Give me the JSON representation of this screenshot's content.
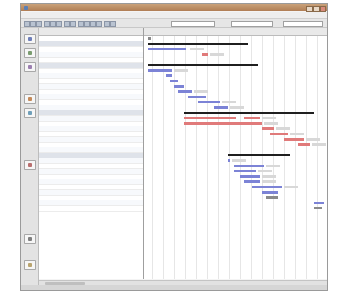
{
  "app": {
    "title": "",
    "icon": "app-icon"
  },
  "menus": [
    "",
    "",
    "",
    "",
    "",
    ""
  ],
  "columns": {
    "id": "",
    "name": "",
    "duration": ""
  },
  "rows": [
    {
      "id": "",
      "name": "",
      "duration": "",
      "kind": "task"
    },
    {
      "id": "",
      "name": "",
      "duration": "",
      "kind": "summary"
    },
    {
      "id": "",
      "name": "",
      "duration": "",
      "kind": "task"
    },
    {
      "id": "",
      "name": "",
      "duration": "",
      "kind": "task"
    },
    {
      "id": "",
      "name": "",
      "duration": "",
      "kind": "task"
    },
    {
      "id": "",
      "name": "",
      "duration": "",
      "kind": "summary"
    },
    {
      "id": "",
      "name": "",
      "duration": "",
      "kind": "task"
    },
    {
      "id": "",
      "name": "",
      "duration": "",
      "kind": "task"
    },
    {
      "id": "",
      "name": "",
      "duration": "",
      "kind": "task"
    },
    {
      "id": "",
      "name": "",
      "duration": "",
      "kind": "task"
    },
    {
      "id": "",
      "name": "",
      "duration": "",
      "kind": "task"
    },
    {
      "id": "",
      "name": "",
      "duration": "",
      "kind": "task"
    },
    {
      "id": "",
      "name": "",
      "duration": "",
      "kind": "task"
    },
    {
      "id": "",
      "name": "",
      "duration": "",
      "kind": "task"
    },
    {
      "id": "",
      "name": "",
      "duration": "",
      "kind": "summary"
    },
    {
      "id": "",
      "name": "",
      "duration": "",
      "kind": "task"
    },
    {
      "id": "",
      "name": "",
      "duration": "",
      "kind": "task"
    },
    {
      "id": "",
      "name": "",
      "duration": "",
      "kind": "task"
    },
    {
      "id": "",
      "name": "",
      "duration": "",
      "kind": "task"
    },
    {
      "id": "",
      "name": "",
      "duration": "",
      "kind": "task"
    },
    {
      "id": "",
      "name": "",
      "duration": "",
      "kind": "task"
    },
    {
      "id": "",
      "name": "",
      "duration": "",
      "kind": "task"
    },
    {
      "id": "",
      "name": "",
      "duration": "",
      "kind": "summary"
    },
    {
      "id": "",
      "name": "",
      "duration": "",
      "kind": "task"
    },
    {
      "id": "",
      "name": "",
      "duration": "",
      "kind": "task"
    },
    {
      "id": "",
      "name": "",
      "duration": "",
      "kind": "task"
    },
    {
      "id": "",
      "name": "",
      "duration": "",
      "kind": "task"
    },
    {
      "id": "",
      "name": "",
      "duration": "",
      "kind": "task"
    },
    {
      "id": "",
      "name": "",
      "duration": "",
      "kind": "task"
    },
    {
      "id": "",
      "name": "",
      "duration": "",
      "kind": "task"
    },
    {
      "id": "",
      "name": "",
      "duration": "",
      "kind": "task"
    },
    {
      "id": "",
      "name": "",
      "duration": "",
      "kind": "task"
    },
    {
      "id": "",
      "name": "",
      "duration": "",
      "kind": "task"
    }
  ],
  "colors": {
    "titlebar": "#b58660",
    "task_bar": "#7c83d6",
    "critical_bar": "#e07a7a",
    "summary_bar": "#1f1f1f",
    "milestone_bar": "#8a8a8a"
  },
  "sidebar_icons": [
    "gantt-view-icon",
    "calendar-view-icon",
    "task-list-icon",
    "resource-icon",
    "chart-icon",
    "report-icon",
    "settings-icon",
    "help-icon"
  ]
}
